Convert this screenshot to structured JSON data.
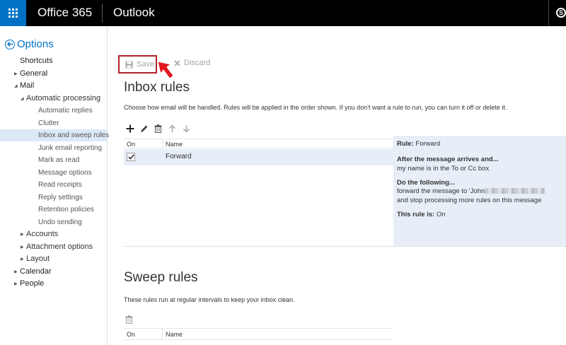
{
  "topbar": {
    "brand": "Office 365",
    "app_name": "Outlook",
    "skype_glyph": "S"
  },
  "nav": {
    "back_label": "Options",
    "items": [
      {
        "label": "Shortcuts",
        "level": 0,
        "expander": "none"
      },
      {
        "label": "General",
        "level": 0,
        "expander": "collapsed"
      },
      {
        "label": "Mail",
        "level": 0,
        "expander": "expanded"
      },
      {
        "label": "Automatic processing",
        "level": 1,
        "expander": "expanded"
      },
      {
        "label": "Automatic replies",
        "level": 2,
        "expander": "none"
      },
      {
        "label": "Clutter",
        "level": 2,
        "expander": "none"
      },
      {
        "label": "Inbox and sweep rules",
        "level": 2,
        "expander": "none",
        "selected": true
      },
      {
        "label": "Junk email reporting",
        "level": 2,
        "expander": "none"
      },
      {
        "label": "Mark as read",
        "level": 2,
        "expander": "none"
      },
      {
        "label": "Message options",
        "level": 2,
        "expander": "none"
      },
      {
        "label": "Read receipts",
        "level": 2,
        "expander": "none"
      },
      {
        "label": "Reply settings",
        "level": 2,
        "expander": "none"
      },
      {
        "label": "Retention policies",
        "level": 2,
        "expander": "none"
      },
      {
        "label": "Undo sending",
        "level": 2,
        "expander": "none"
      },
      {
        "label": "Accounts",
        "level": 1,
        "expander": "collapsed"
      },
      {
        "label": "Attachment options",
        "level": 1,
        "expander": "collapsed"
      },
      {
        "label": "Layout",
        "level": 1,
        "expander": "collapsed"
      },
      {
        "label": "Calendar",
        "level": 0,
        "expander": "collapsed"
      },
      {
        "label": "People",
        "level": 0,
        "expander": "collapsed"
      }
    ]
  },
  "toolbar": {
    "save_label": "Save",
    "discard_label": "Discard"
  },
  "inbox_rules": {
    "title": "Inbox rules",
    "description": "Choose how email will be handled. Rules will be applied in the order shown. If you don't want a rule to run, you can turn it off or delete it.",
    "columns": {
      "on": "On",
      "name": "Name"
    },
    "rows": [
      {
        "enabled": true,
        "name": "Forward"
      }
    ],
    "details": {
      "rule_label": "Rule:",
      "rule_name": "Forward",
      "after_heading": "After the message arrives and...",
      "condition": "my name is in the To or Cc box",
      "do_heading": "Do the following...",
      "action_prefix": "forward the message to 'John",
      "action_suffix": "and stop processing more rules on this message",
      "status_label": "This rule is:",
      "status_value": "On"
    }
  },
  "sweep_rules": {
    "title": "Sweep rules",
    "description": "These rules run at regular intervals to keep your inbox clean.",
    "columns": {
      "on": "On",
      "name": "Name"
    }
  },
  "colors": {
    "brand_blue": "#0072c6",
    "highlight_red": "#b3202a",
    "selection": "#dbe8f6"
  }
}
